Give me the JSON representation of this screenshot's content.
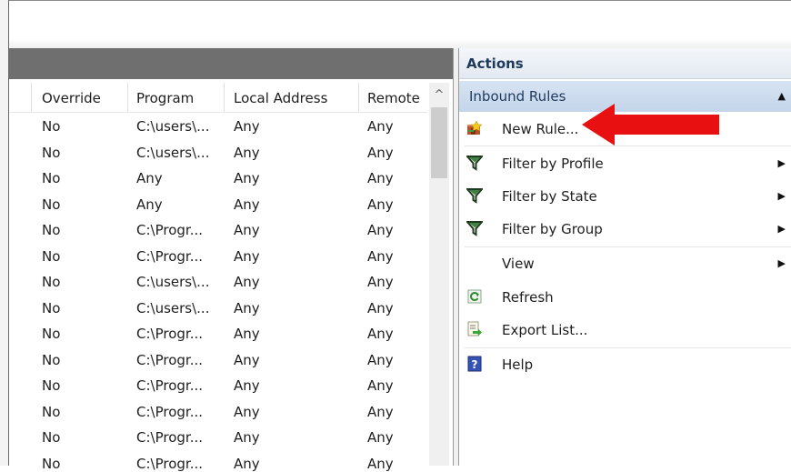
{
  "list": {
    "columns": [
      "Override",
      "Program",
      "Local Address",
      "Remote"
    ],
    "rows": [
      [
        "No",
        "C:\\users\\...",
        "Any",
        "Any"
      ],
      [
        "No",
        "C:\\users\\...",
        "Any",
        "Any"
      ],
      [
        "No",
        "Any",
        "Any",
        "Any"
      ],
      [
        "No",
        "Any",
        "Any",
        "Any"
      ],
      [
        "No",
        "C:\\Progr...",
        "Any",
        "Any"
      ],
      [
        "No",
        "C:\\Progr...",
        "Any",
        "Any"
      ],
      [
        "No",
        "C:\\users\\...",
        "Any",
        "Any"
      ],
      [
        "No",
        "C:\\users\\...",
        "Any",
        "Any"
      ],
      [
        "No",
        "C:\\Progr...",
        "Any",
        "Any"
      ],
      [
        "No",
        "C:\\Progr...",
        "Any",
        "Any"
      ],
      [
        "No",
        "C:\\Progr...",
        "Any",
        "Any"
      ],
      [
        "No",
        "C:\\Progr...",
        "Any",
        "Any"
      ],
      [
        "No",
        "C:\\Progr...",
        "Any",
        "Any"
      ],
      [
        "No",
        "C:\\Progr...",
        "Any",
        "Any"
      ]
    ]
  },
  "actions": {
    "title": "Actions",
    "section": "Inbound Rules",
    "items": [
      {
        "label": "New Rule...",
        "icon": "new-rule-icon",
        "submenu": false
      },
      {
        "label": "Filter by Profile",
        "icon": "filter-icon",
        "submenu": true
      },
      {
        "label": "Filter by State",
        "icon": "filter-icon",
        "submenu": true
      },
      {
        "label": "Filter by Group",
        "icon": "filter-icon",
        "submenu": true
      },
      {
        "label": "View",
        "icon": "",
        "submenu": true
      },
      {
        "label": "Refresh",
        "icon": "refresh-icon",
        "submenu": false
      },
      {
        "label": "Export List...",
        "icon": "export-icon",
        "submenu": false
      },
      {
        "label": "Help",
        "icon": "help-icon",
        "submenu": false
      }
    ]
  },
  "colors": {
    "arrow": "#e81010",
    "section_bg": "#c9daee",
    "header_bar": "#6f6f6f"
  }
}
